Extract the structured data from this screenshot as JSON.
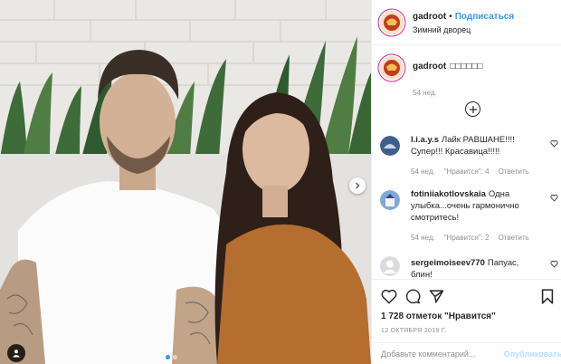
{
  "post": {
    "username": "gadroot",
    "separator": "•",
    "follow_label": "Подписаться",
    "location": "Зимний дворец",
    "caption": "□□□□□□",
    "caption_time": "54 нед."
  },
  "comments": [
    {
      "username": "l.i.a.y.s",
      "text": "Лайк РАВШАНЕ!!!! Супер!!! Красавица!!!!!",
      "time": "54 нед.",
      "likes_label": "\"Нравится\": 4",
      "reply_label": "Ответить"
    },
    {
      "username": "fotiniiakotlovskaia",
      "text": "Одна улыбка...очень гармонично смотритесь!",
      "time": "54 нед.",
      "likes_label": "\"Нравится\": 2",
      "reply_label": "Ответить"
    },
    {
      "username": "sergeimoiseev770",
      "text": "Папуас, блин!"
    }
  ],
  "stats": {
    "likes_text": "1 728 отметок \"Нравится\"",
    "date": "12 ОКТЯБРЯ 2019 Г."
  },
  "comment_box": {
    "placeholder": "Добавьте комментарий...",
    "publish_label": "Опубликовать"
  },
  "carousel": {
    "dots": 2,
    "active": 1
  },
  "icons": [
    "heart-icon",
    "comment-icon",
    "share-icon",
    "bookmark-icon",
    "plus-circle-icon",
    "chevron-right-icon",
    "user-tag-icon"
  ],
  "colors": {
    "link": "#3897f0",
    "muted": "#8e8e8e",
    "text": "#262626",
    "publish_disabled": "#b2dffc"
  }
}
